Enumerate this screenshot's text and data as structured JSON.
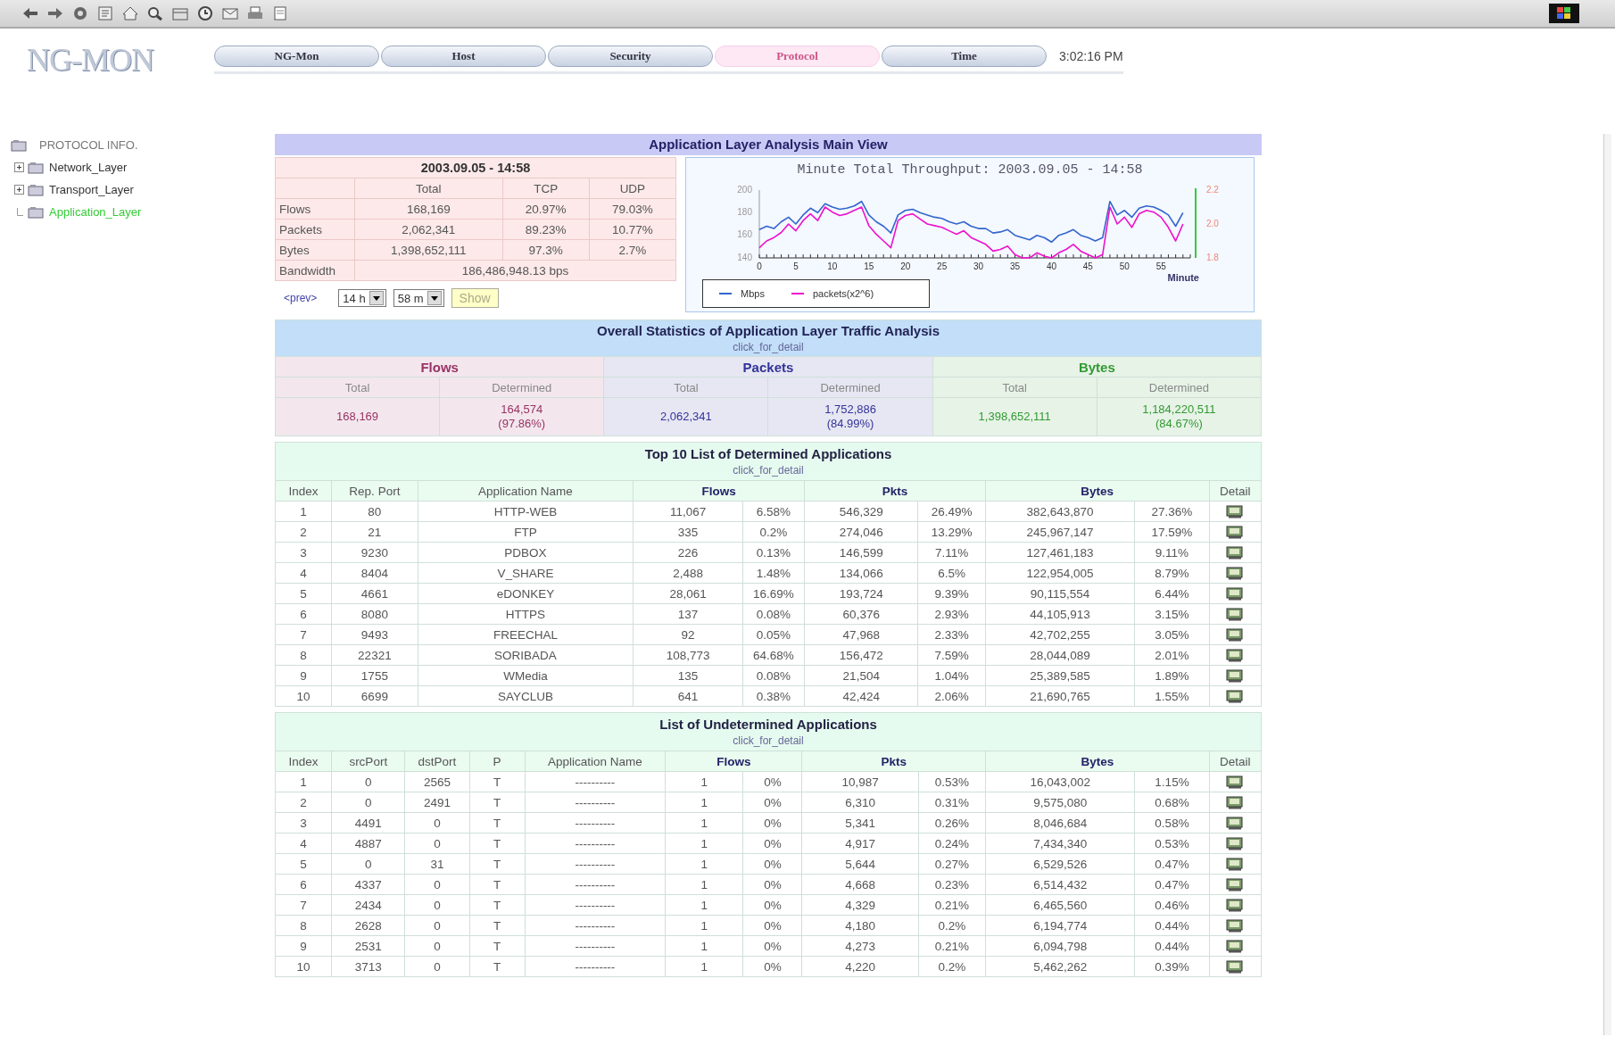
{
  "logo": "NG-MON",
  "nav_tabs": [
    {
      "label": "NG-Mon",
      "selected": false
    },
    {
      "label": "Host",
      "selected": false
    },
    {
      "label": "Security",
      "selected": false
    },
    {
      "label": "Protocol",
      "selected": true
    },
    {
      "label": "Time",
      "selected": false
    }
  ],
  "clock": "3:02:16 PM",
  "tree": {
    "label": "PROTOCOL INFO.",
    "children": [
      {
        "label": "Network_Layer",
        "kind": "branch",
        "selected": false
      },
      {
        "label": "Transport_Layer",
        "kind": "branch",
        "selected": false
      },
      {
        "label": "Application_Layer",
        "kind": "leaf",
        "selected": true
      }
    ]
  },
  "main_title": "Application Layer Analysis Main View",
  "summary": {
    "title": "2003.09.05 - 14:58",
    "headers": [
      "Total",
      "TCP",
      "UDP"
    ],
    "rows": [
      {
        "label": "Flows",
        "cells": [
          "168,169",
          "20.97%",
          "79.03%"
        ]
      },
      {
        "label": "Packets",
        "cells": [
          "2,062,341",
          "89.23%",
          "10.77%"
        ]
      },
      {
        "label": "Bytes",
        "cells": [
          "1,398,652,111",
          "97.3%",
          "2.7%"
        ]
      }
    ],
    "bandwidth": {
      "label": "Bandwidth",
      "value": "186,486,948.13 bps"
    }
  },
  "controls": {
    "prev_link": "<prev>",
    "hour": "14 h",
    "minute": "58 m",
    "show_button": "Show"
  },
  "chart": {
    "chart_data": {
      "type": "line",
      "title": "Minute Total Throughput: 2003.09.05 - 14:58",
      "xlabel": "Minute",
      "xlim": [
        0,
        59
      ],
      "ylim": [
        140,
        200
      ],
      "y2lim": [
        1.8,
        2.2
      ],
      "x": [
        0,
        1,
        2,
        3,
        4,
        5,
        6,
        7,
        8,
        9,
        10,
        11,
        12,
        13,
        14,
        15,
        16,
        17,
        18,
        19,
        20,
        21,
        22,
        23,
        24,
        25,
        26,
        27,
        28,
        29,
        30,
        31,
        32,
        33,
        34,
        35,
        36,
        37,
        38,
        39,
        40,
        41,
        42,
        43,
        44,
        45,
        46,
        47,
        48,
        49,
        50,
        51,
        52,
        53,
        54,
        55,
        56,
        57,
        58
      ],
      "xticks": [
        0,
        5,
        10,
        15,
        20,
        25,
        30,
        35,
        40,
        45,
        50,
        55
      ],
      "yticks": [
        140,
        160,
        180,
        200
      ],
      "y2ticks": [
        {
          "value": 1.8,
          "label": "1.8"
        },
        {
          "value": 2.0,
          "label": "2.0"
        },
        {
          "value": 2.2,
          "label": "2.2"
        }
      ],
      "series": [
        {
          "name": "Mbps",
          "color": "#3366cc",
          "values": [
            165,
            168,
            166,
            172,
            176,
            170,
            178,
            184,
            180,
            188,
            185,
            183,
            184,
            186,
            190,
            178,
            172,
            168,
            162,
            178,
            182,
            183,
            180,
            178,
            176,
            175,
            172,
            170,
            172,
            168,
            166,
            166,
            162,
            163,
            165,
            160,
            158,
            156,
            160,
            158,
            154,
            160,
            162,
            165,
            160,
            158,
            155,
            158,
            190,
            178,
            182,
            176,
            184,
            186,
            185,
            182,
            178,
            168,
            180
          ]
        },
        {
          "name": "packets(x2^6)",
          "color": "#ee11cc",
          "axis": "y2",
          "values": [
            1.86,
            1.9,
            1.92,
            1.95,
            2.0,
            1.96,
            2.02,
            2.06,
            2.02,
            2.1,
            2.07,
            2.05,
            2.06,
            2.08,
            2.1,
            1.99,
            1.94,
            1.9,
            1.86,
            2.02,
            2.05,
            2.06,
            2.03,
            2.0,
            1.99,
            1.98,
            1.96,
            1.94,
            1.96,
            1.92,
            1.9,
            1.88,
            1.84,
            1.85,
            1.87,
            1.82,
            1.8,
            1.8,
            1.83,
            1.81,
            1.8,
            1.83,
            1.85,
            1.88,
            1.84,
            1.82,
            1.8,
            1.82,
            2.1,
            2.0,
            2.04,
            1.98,
            2.06,
            2.08,
            2.07,
            2.04,
            1.98,
            1.9,
            2.0
          ]
        }
      ]
    }
  },
  "overall": {
    "title": "Overall Statistics of Application Layer Traffic Analysis",
    "link": "click_for_detail",
    "groups": [
      {
        "label": "Flows",
        "color": "#993366",
        "total_label": "Total",
        "determined_label": "Determined",
        "total": "168,169",
        "determined": "164,574",
        "determined_pct": "(97.86%)"
      },
      {
        "label": "Packets",
        "color": "#333399",
        "total_label": "Total",
        "determined_label": "Determined",
        "total": "2,062,341",
        "determined": "1,752,886",
        "determined_pct": "(84.99%)"
      },
      {
        "label": "Bytes",
        "color": "#339933",
        "total_label": "Total",
        "determined_label": "Determined",
        "total": "1,398,652,111",
        "determined": "1,184,220,511",
        "determined_pct": "(84.67%)"
      }
    ]
  },
  "top10": {
    "title": "Top 10 List of Determined Applications",
    "link": "click_for_detail",
    "columns": [
      {
        "label": "Index",
        "kind": "plain"
      },
      {
        "label": "Rep. Port",
        "kind": "plain"
      },
      {
        "label": "Application Name",
        "kind": "plain"
      },
      {
        "label": "Flows",
        "kind": "metric",
        "colspan": 2
      },
      {
        "label": "Pkts",
        "kind": "metric",
        "colspan": 2
      },
      {
        "label": "Bytes",
        "kind": "metric",
        "colspan": 2
      },
      {
        "label": "Detail",
        "kind": "plain"
      }
    ],
    "rows": [
      [
        "1",
        "80",
        "HTTP-WEB",
        "11,067",
        "6.58%",
        "546,329",
        "26.49%",
        "382,643,870",
        "27.36%"
      ],
      [
        "2",
        "21",
        "FTP",
        "335",
        "0.2%",
        "274,046",
        "13.29%",
        "245,967,147",
        "17.59%"
      ],
      [
        "3",
        "9230",
        "PDBOX",
        "226",
        "0.13%",
        "146,599",
        "7.11%",
        "127,461,183",
        "9.11%"
      ],
      [
        "4",
        "8404",
        "V_SHARE",
        "2,488",
        "1.48%",
        "134,066",
        "6.5%",
        "122,954,005",
        "8.79%"
      ],
      [
        "5",
        "4661",
        "eDONKEY",
        "28,061",
        "16.69%",
        "193,724",
        "9.39%",
        "90,115,554",
        "6.44%"
      ],
      [
        "6",
        "8080",
        "HTTPS",
        "137",
        "0.08%",
        "60,376",
        "2.93%",
        "44,105,913",
        "3.15%"
      ],
      [
        "7",
        "9493",
        "FREECHAL",
        "92",
        "0.05%",
        "47,968",
        "2.33%",
        "42,702,255",
        "3.05%"
      ],
      [
        "8",
        "22321",
        "SORIBADA",
        "108,773",
        "64.68%",
        "156,472",
        "7.59%",
        "28,044,089",
        "2.01%"
      ],
      [
        "9",
        "1755",
        "WMedia",
        "135",
        "0.08%",
        "21,504",
        "1.04%",
        "25,389,585",
        "1.89%"
      ],
      [
        "10",
        "6699",
        "SAYCLUB",
        "641",
        "0.38%",
        "42,424",
        "2.06%",
        "21,690,765",
        "1.55%"
      ]
    ]
  },
  "undetermined": {
    "title": "List of Undetermined Applications",
    "link": "click_for_detail",
    "columns": [
      {
        "label": "Index",
        "kind": "plain"
      },
      {
        "label": "srcPort",
        "kind": "plain"
      },
      {
        "label": "dstPort",
        "kind": "plain"
      },
      {
        "label": "P",
        "kind": "plain"
      },
      {
        "label": "Application Name",
        "kind": "plain"
      },
      {
        "label": "Flows",
        "kind": "metric",
        "colspan": 2
      },
      {
        "label": "Pkts",
        "kind": "metric",
        "colspan": 2
      },
      {
        "label": "Bytes",
        "kind": "metric",
        "colspan": 2
      },
      {
        "label": "Detail",
        "kind": "plain"
      }
    ],
    "rows": [
      [
        "1",
        "0",
        "2565",
        "T",
        "----------",
        "1",
        "0%",
        "10,987",
        "0.53%",
        "16,043,002",
        "1.15%"
      ],
      [
        "2",
        "0",
        "2491",
        "T",
        "----------",
        "1",
        "0%",
        "6,310",
        "0.31%",
        "9,575,080",
        "0.68%"
      ],
      [
        "3",
        "4491",
        "0",
        "T",
        "----------",
        "1",
        "0%",
        "5,341",
        "0.26%",
        "8,046,684",
        "0.58%"
      ],
      [
        "4",
        "4887",
        "0",
        "T",
        "----------",
        "1",
        "0%",
        "4,917",
        "0.24%",
        "7,434,340",
        "0.53%"
      ],
      [
        "5",
        "0",
        "31",
        "T",
        "----------",
        "1",
        "0%",
        "5,644",
        "0.27%",
        "6,529,526",
        "0.47%"
      ],
      [
        "6",
        "4337",
        "0",
        "T",
        "----------",
        "1",
        "0%",
        "4,668",
        "0.23%",
        "6,514,432",
        "0.47%"
      ],
      [
        "7",
        "2434",
        "0",
        "T",
        "----------",
        "1",
        "0%",
        "4,329",
        "0.21%",
        "6,465,560",
        "0.46%"
      ],
      [
        "8",
        "2628",
        "0",
        "T",
        "----------",
        "1",
        "0%",
        "4,180",
        "0.2%",
        "6,194,774",
        "0.44%"
      ],
      [
        "9",
        "2531",
        "0",
        "T",
        "----------",
        "1",
        "0%",
        "4,273",
        "0.21%",
        "6,094,798",
        "0.44%"
      ],
      [
        "10",
        "3713",
        "0",
        "T",
        "----------",
        "1",
        "0%",
        "4,220",
        "0.2%",
        "5,462,262",
        "0.39%"
      ]
    ]
  }
}
